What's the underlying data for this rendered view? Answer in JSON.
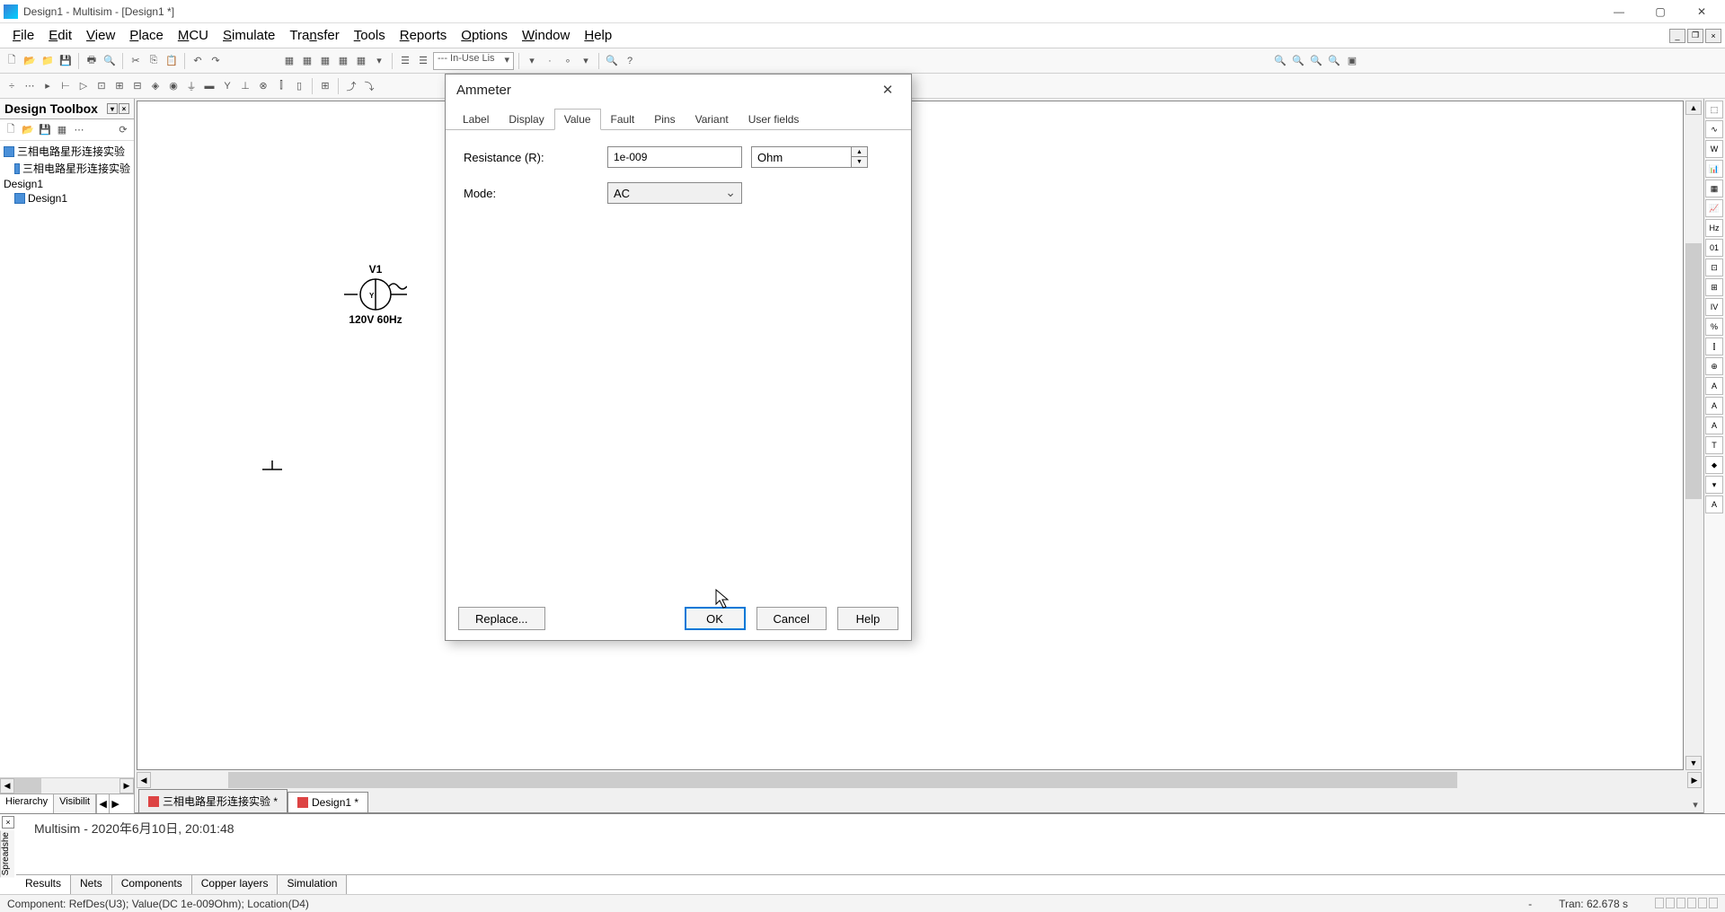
{
  "window": {
    "title": "Design1 - Multisim - [Design1 *]"
  },
  "menus": [
    "File",
    "Edit",
    "View",
    "Place",
    "MCU",
    "Simulate",
    "Transfer",
    "Tools",
    "Reports",
    "Options",
    "Window",
    "Help"
  ],
  "toolbar1_combo": "--- In-Use Lis",
  "toolbox": {
    "title": "Design Toolbox",
    "tree": [
      "三相电路星形连接实验",
      "三相电路星形连接实验",
      "Design1",
      "Design1"
    ],
    "tabs": [
      "Hierarchy",
      "Visibilit"
    ]
  },
  "doc_tabs": [
    "三相电路星形连接实验 *",
    "Design1 *"
  ],
  "canvas": {
    "v1_label": "V1",
    "v1_value": "120V 60Hz"
  },
  "dialog": {
    "title": "Ammeter",
    "tabs": [
      "Label",
      "Display",
      "Value",
      "Fault",
      "Pins",
      "Variant",
      "User fields"
    ],
    "active_tab": "Value",
    "resistance_label": "Resistance (R):",
    "resistance_value": "1e-009",
    "resistance_unit": "Ohm",
    "mode_label": "Mode:",
    "mode_value": "AC",
    "replace": "Replace...",
    "ok": "OK",
    "cancel": "Cancel",
    "help": "Help"
  },
  "bottom": {
    "vlabel": "Spreadshe",
    "content": "Multisim  -  2020年6月10日, 20:01:48",
    "tabs": [
      "Results",
      "Nets",
      "Components",
      "Copper layers",
      "Simulation"
    ]
  },
  "status": {
    "left": "Component: RefDes(U3); Value(DC  1e-009Ohm); Location(D4)",
    "tran": "Tran: 62.678 s"
  }
}
